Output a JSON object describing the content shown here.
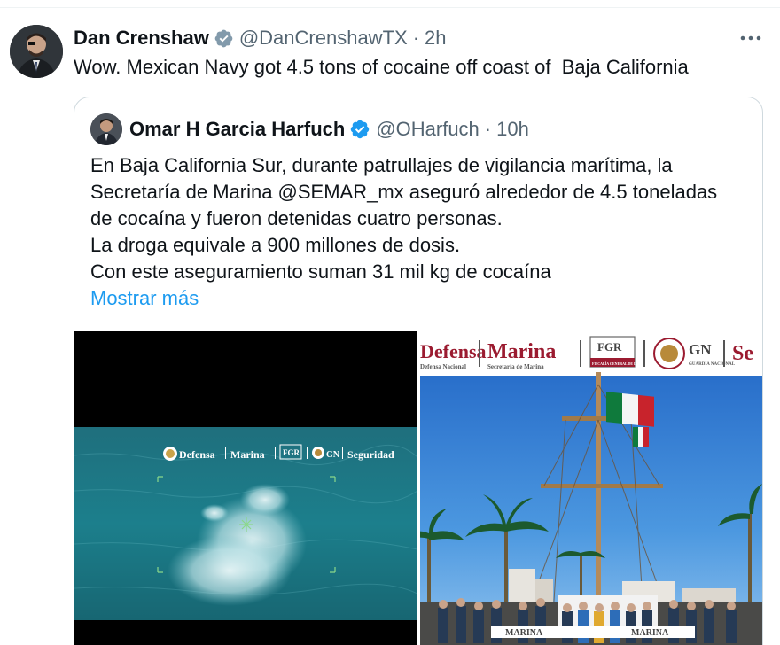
{
  "tweet": {
    "author_name": "Dan Crenshaw",
    "author_handle": "@DanCrenshawTX",
    "separator": "·",
    "time": "2h",
    "text": "Wow. Mexican Navy got 4.5 tons of cocaine off coast of  Baja California"
  },
  "quoted": {
    "author_name": "Omar H Garcia Harfuch",
    "author_handle": "@OHarfuch",
    "separator": "·",
    "time": "10h",
    "lines": [
      "En Baja California Sur, durante patrullajes de vigilancia marítima, la",
      "Secretaría de Marina @SEMAR_mx aseguró alrededor de 4.5 toneladas",
      "de cocaína y fueron detenidas cuatro personas.",
      "La droga equivale a 900 millones de dosis.",
      "Con este aseguramiento suman 31 mil kg de cocaína"
    ],
    "show_more": "Mostrar más"
  },
  "media": {
    "left_banner": [
      "Defensa",
      "Marina",
      "FGR",
      "GN",
      "Seguridad"
    ],
    "right_banner": [
      "Defensa",
      "Marina",
      "FGR",
      "GN",
      "Se"
    ],
    "right_banner_sub": [
      "Defensa Nacional",
      "Secretaría de Marina",
      "FISCALÍA GENERAL DE LA REPÚBLICA",
      "GUARDIA NACIONAL"
    ],
    "podium_text": [
      "MARINA",
      "MARINA"
    ]
  },
  "colors": {
    "link": "#1d9bf0",
    "verified": "#1d9bf0",
    "secondary_text": "#536471",
    "border": "#cfd9de",
    "marina_red": "#9b1b30"
  }
}
